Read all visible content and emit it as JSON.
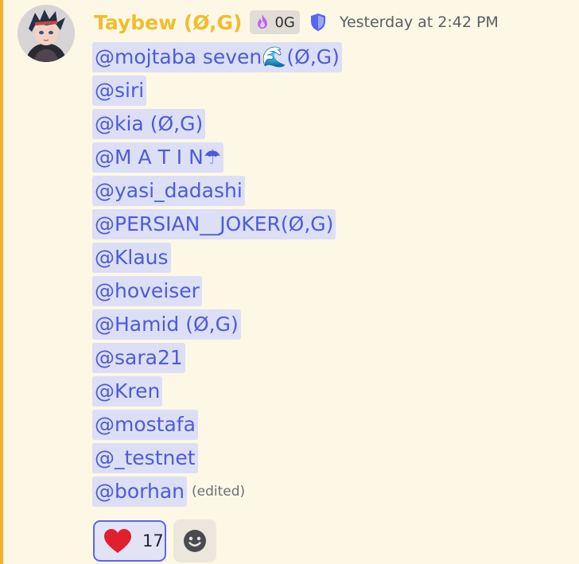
{
  "message": {
    "author": "Taybew (Ø,G)",
    "tag": "0G",
    "timestamp": "Yesterday at 2:42 PM",
    "mentions": [
      "@mojtaba seven🌊(Ø,G)",
      "@siri",
      "@kia (Ø,G)",
      "@M A T I N☂",
      "@yasi_dadashi",
      "@PERSIAN__JOKER(Ø,G)",
      "@Klaus",
      "@hoveiser",
      "@Hamid (Ø,G)",
      "@sara21",
      "@Kren",
      "@mostafa",
      "@_testnet",
      "@borhan"
    ],
    "edited_label": "(edited)"
  },
  "reactions": [
    {
      "icon": "heart-icon",
      "count": "17"
    }
  ],
  "colors": {
    "username": "#f0bd2e",
    "mention_text": "#4e5bd8",
    "mention_bg": "#dcdff5",
    "reaction_border": "#5865f2",
    "background": "#fdf7e6"
  }
}
